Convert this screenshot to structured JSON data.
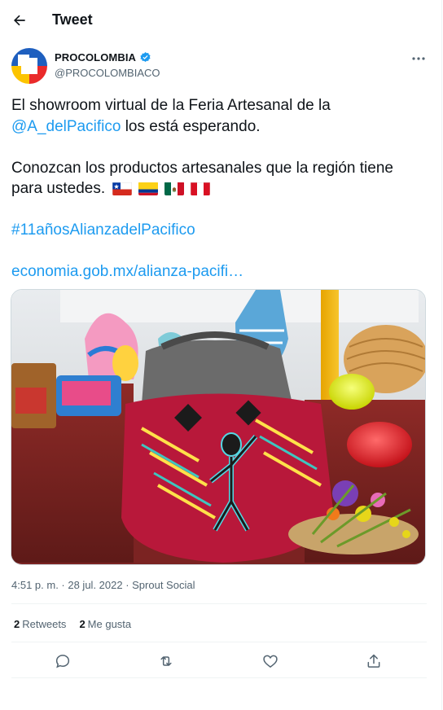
{
  "header": {
    "title": "Tweet"
  },
  "author": {
    "name": "PROCOLOMBIA",
    "handle": "@PROCOLOMBIACO",
    "verified": true
  },
  "tweet": {
    "line1_text": "El showroom virtual de la Feria Artesanal de la",
    "mention": "@A_delPacifico",
    "line2_rest": " los está esperando.",
    "paragraph2": "Conozcan los productos artesanales que la región tiene para ustedes.",
    "flags": [
      "Chile",
      "Colombia",
      "México",
      "Perú"
    ],
    "hashtag": "#11añosAlianzadelPacifico",
    "link": "economia.gob.mx/alianza-pacifi…"
  },
  "meta": {
    "timestamp": "4:51 p. m. · 28 jul. 2022 · Sprout Social"
  },
  "stats": {
    "retweets_count": "2",
    "retweets_label": "Retweets",
    "likes_count": "2",
    "likes_label": "Me gusta"
  },
  "colors": {
    "accent": "#1d9bf0",
    "secondary_text": "#536471",
    "border": "#eff3f4"
  },
  "icons": [
    "back-arrow-icon",
    "verified-badge-icon",
    "more-icon",
    "reply-icon",
    "retweet-icon",
    "like-icon",
    "share-icon"
  ]
}
